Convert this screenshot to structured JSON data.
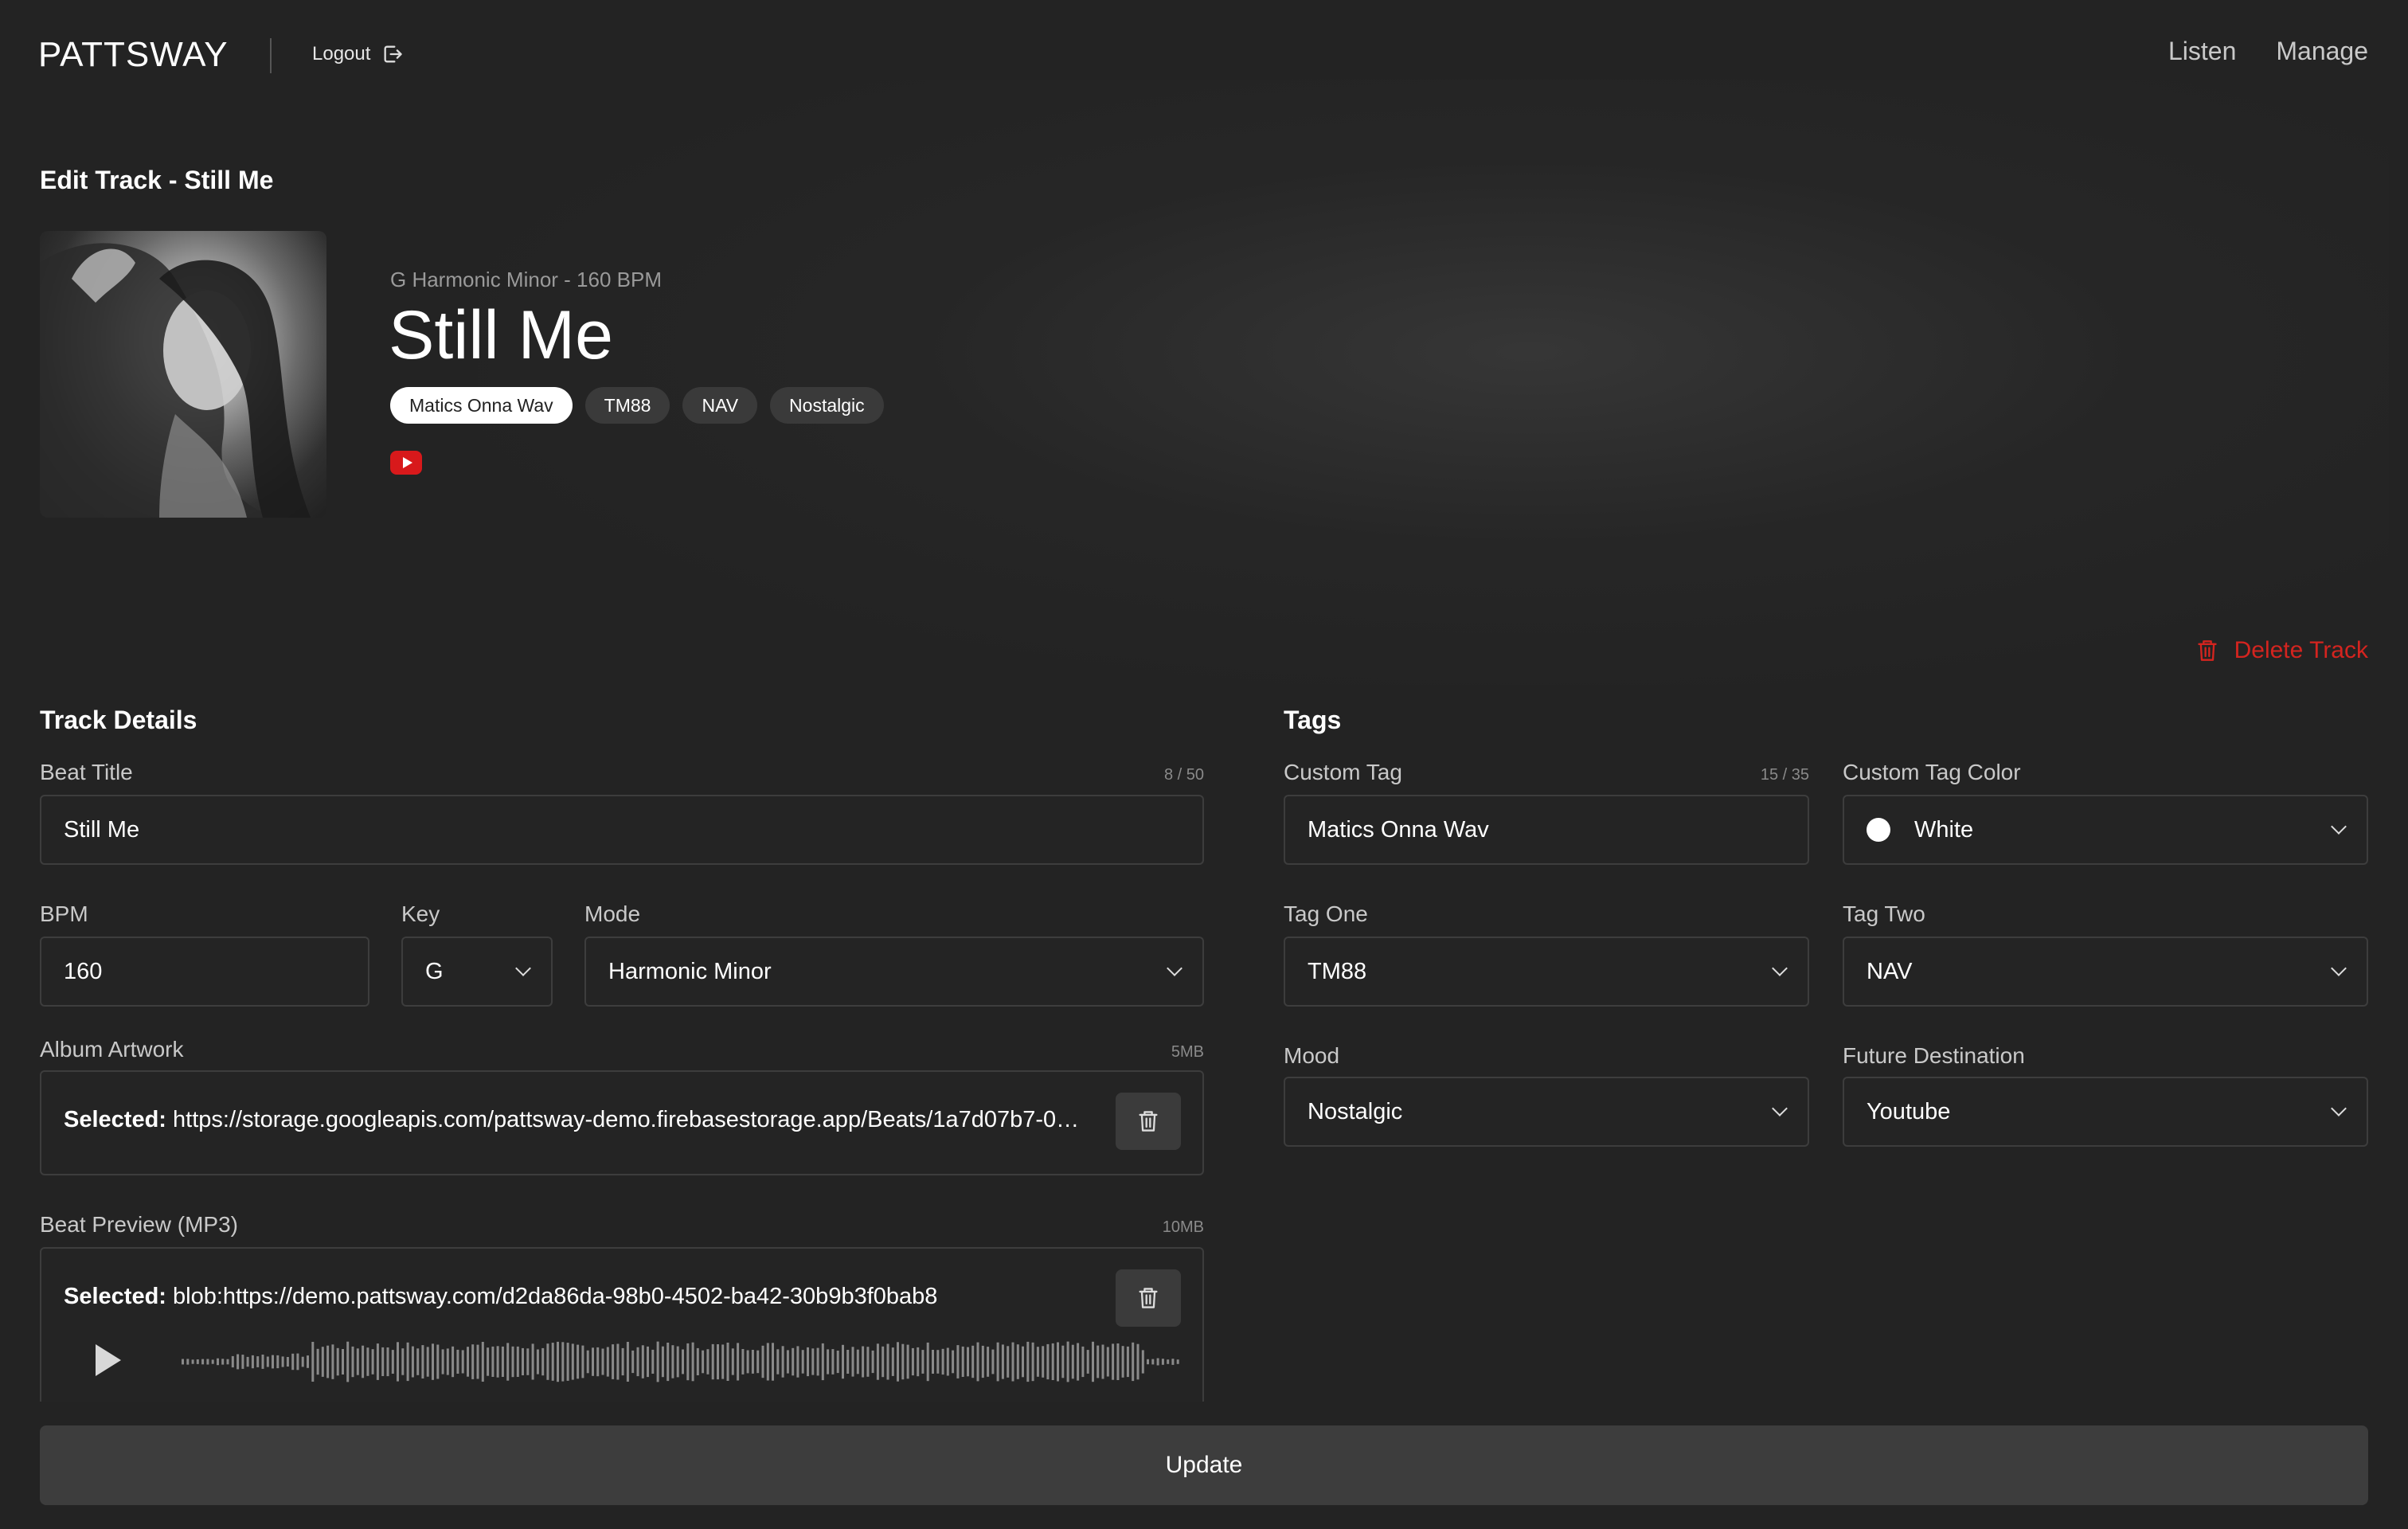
{
  "header": {
    "logo": "PATTSWAY",
    "logout_label": "Logout",
    "nav": [
      "Listen",
      "Manage"
    ]
  },
  "page_title": "Edit Track - Still Me",
  "hero": {
    "meta": "G Harmonic Minor - 160 BPM",
    "title": "Still Me",
    "tags": [
      "Matics Onna Wav",
      "TM88",
      "NAV",
      "Nostalgic"
    ],
    "destination_icon": "youtube-icon"
  },
  "delete_label": "Delete Track",
  "track_details": {
    "heading": "Track Details",
    "beat_title": {
      "label": "Beat Title",
      "counter": "8 / 50",
      "value": "Still Me"
    },
    "bpm": {
      "label": "BPM",
      "value": "160"
    },
    "key": {
      "label": "Key",
      "value": "G"
    },
    "mode": {
      "label": "Mode",
      "value": "Harmonic Minor"
    },
    "artwork": {
      "label": "Album Artwork",
      "limit": "5MB",
      "selected_prefix": "Selected:",
      "selected_value": "https://storage.googleapis.com/pattsway-demo.firebasestorage.app/Beats/1a7d07b7-0…"
    },
    "preview": {
      "label": "Beat Preview (MP3)",
      "limit": "10MB",
      "selected_prefix": "Selected:",
      "selected_value": "blob:https://demo.pattsway.com/d2da86da-98b0-4502-ba42-30b9b3f0bab8"
    }
  },
  "tags": {
    "heading": "Tags",
    "custom_tag": {
      "label": "Custom Tag",
      "counter": "15 / 35",
      "value": "Matics Onna Wav"
    },
    "custom_tag_color": {
      "label": "Custom Tag Color",
      "value": "White",
      "color": "#ffffff"
    },
    "tag_one": {
      "label": "Tag One",
      "value": "TM88"
    },
    "tag_two": {
      "label": "Tag Two",
      "value": "NAV"
    },
    "mood": {
      "label": "Mood",
      "value": "Nostalgic"
    },
    "future_destination": {
      "label": "Future Destination",
      "value": "Youtube"
    }
  },
  "update_label": "Update",
  "colors": {
    "background": "#232323",
    "danger": "#d4241f",
    "youtube": "#d8191b",
    "button": "#3d3d3d"
  }
}
